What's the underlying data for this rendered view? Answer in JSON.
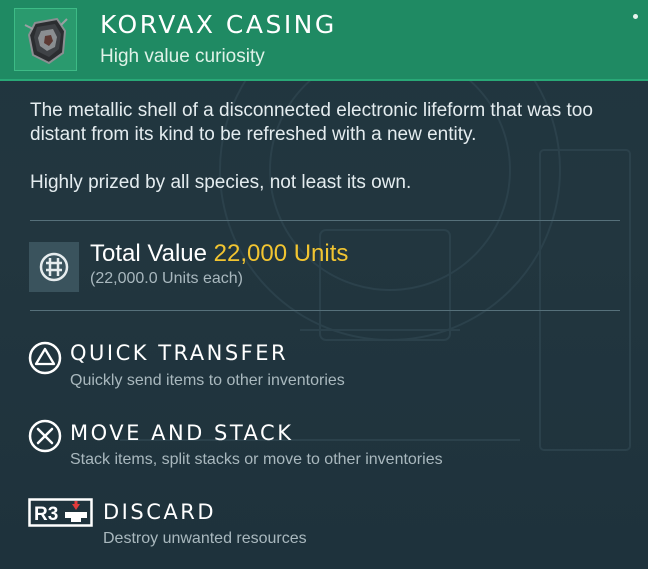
{
  "item": {
    "title": "KORVAX CASING",
    "subtitle": "High value curiosity",
    "icon": "korvax-casing-icon",
    "description": [
      "The metallic shell of a disconnected electronic lifeform that was too distant from its kind to be refreshed with a new entity.",
      "Highly prized by all species, not least its own."
    ]
  },
  "value": {
    "label": "Total Value",
    "amount": "22,000 Units",
    "each": "(22,000.0 Units each)",
    "icon": "units-currency-icon"
  },
  "actions": [
    {
      "button": "triangle-button-icon",
      "label": "QUICK TRANSFER",
      "hint": "Quickly send items to other inventories"
    },
    {
      "button": "cross-button-icon",
      "label": "MOVE AND STACK",
      "hint": "Stack items, split stacks or move to other inventories"
    },
    {
      "button": "r3-button-icon",
      "button_text": "R3",
      "label": "DISCARD",
      "hint": "Destroy unwanted resources"
    }
  ],
  "colors": {
    "header": "#1f8a63",
    "panel": "#20353f",
    "value_accent": "#f2c531",
    "discard_accent": "#e23b3b"
  }
}
